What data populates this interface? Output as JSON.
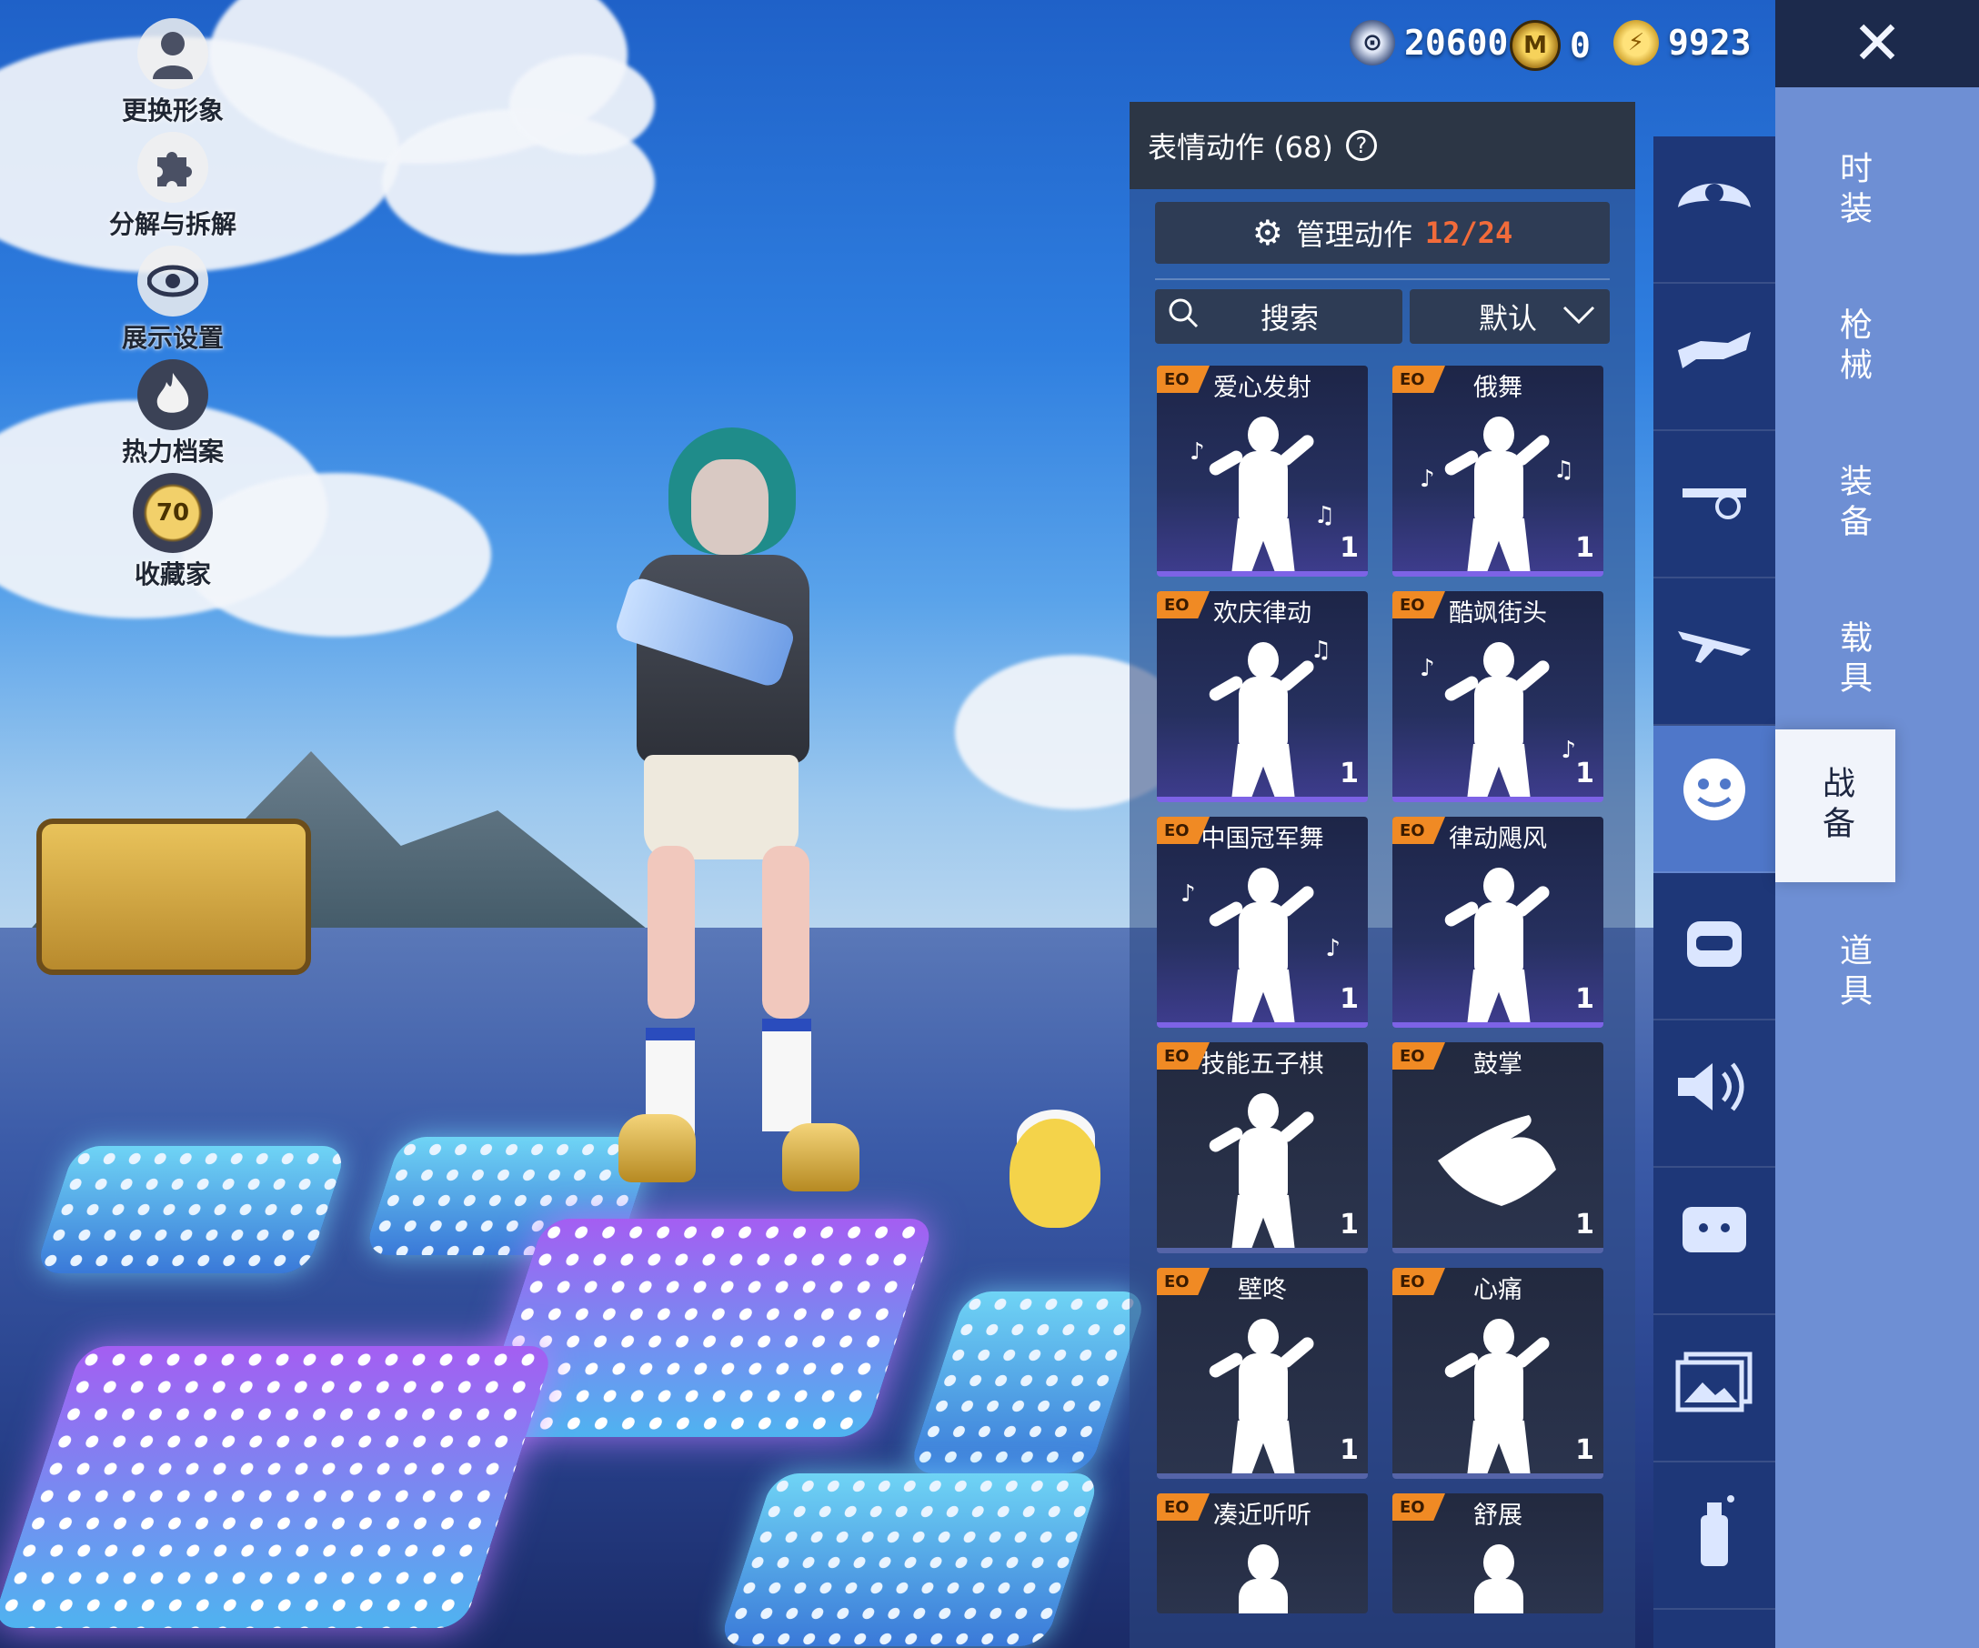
{
  "left_menu": [
    {
      "label": "更换形象",
      "icon": "avatar-icon"
    },
    {
      "label": "分解与拆解",
      "icon": "puzzle-icon"
    },
    {
      "label": "展示设置",
      "icon": "eye-icon"
    },
    {
      "label": "热力档案",
      "icon": "flame-icon"
    },
    {
      "label": "收藏家",
      "icon": "collector-badge-icon",
      "badge": "70"
    }
  ],
  "currency": [
    {
      "icon": "silver-coin-icon",
      "value": "20600"
    },
    {
      "icon": "gold-medal-icon",
      "value": "0"
    },
    {
      "icon": "lightning-coin-icon",
      "value": "9923"
    }
  ],
  "close_label": "✕",
  "panel": {
    "title": "表情动作 (68)",
    "help": "?",
    "manage_label": "管理动作",
    "manage_count": "12/24",
    "search_label": "搜索",
    "sort_label": "默认"
  },
  "emotes": [
    {
      "name": "爱心发射",
      "count": "1",
      "tag": "EO"
    },
    {
      "name": "俄舞",
      "count": "1",
      "tag": "EO"
    },
    {
      "name": "欢庆律动",
      "count": "1",
      "tag": "EO"
    },
    {
      "name": "酷飒街头",
      "count": "1",
      "tag": "EO"
    },
    {
      "name": "中国冠军舞",
      "count": "1",
      "tag": "EO"
    },
    {
      "name": "律动飓风",
      "count": "1",
      "tag": "EO"
    },
    {
      "name": "技能五子棋",
      "count": "1",
      "tag": "EO"
    },
    {
      "name": "鼓掌",
      "count": "1",
      "tag": "EO"
    },
    {
      "name": "壁咚",
      "count": "1",
      "tag": "EO"
    },
    {
      "name": "心痛",
      "count": "1",
      "tag": "EO"
    },
    {
      "name": "凑近听听",
      "count": "",
      "tag": "EO"
    },
    {
      "name": "舒展",
      "count": "",
      "tag": "EO"
    }
  ],
  "categories": [
    {
      "icon": "parachute-icon"
    },
    {
      "icon": "skydive-icon"
    },
    {
      "icon": "drone-icon"
    },
    {
      "icon": "plane-icon"
    },
    {
      "icon": "smiley-emote-icon",
      "active": true
    },
    {
      "icon": "robot-pet-icon"
    },
    {
      "icon": "speaker-voice-icon"
    },
    {
      "icon": "chat-bubble-icon"
    },
    {
      "icon": "photo-gallery-icon"
    },
    {
      "icon": "spray-can-icon"
    }
  ],
  "tabs": [
    {
      "label": "时装"
    },
    {
      "label": "枪械"
    },
    {
      "label": "装备"
    },
    {
      "label": "载具"
    },
    {
      "label": "战备",
      "active": true
    },
    {
      "label": "道具"
    }
  ],
  "colors": {
    "accent_orange": "#f08a24",
    "count_red": "#f26b3a",
    "tab_bg": "#6e8fd4"
  }
}
